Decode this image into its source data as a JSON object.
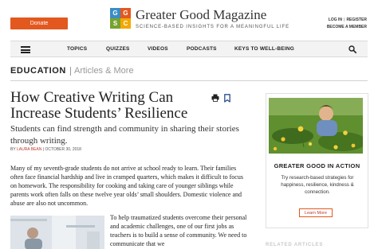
{
  "header": {
    "donate_label": "Donate",
    "logo_letters": [
      "G",
      "G",
      "S",
      "C"
    ],
    "logo_colors": [
      "#3a8dc4",
      "#e3581f",
      "#78a22f",
      "#f2a900"
    ],
    "title": "Greater Good Magazine",
    "tagline": "SCIENCE-BASED INSIGHTS FOR A MEANINGFUL LIFE",
    "log_in": "LOG IN",
    "separator": "|",
    "register": "REGISTER",
    "become_member": "BECOME A MEMBER"
  },
  "nav": {
    "menu_icon": "hamburger-icon",
    "items": [
      "TOPICS",
      "QUIZZES",
      "VIDEOS",
      "PODCASTS",
      "KEYS TO WELL-BEING"
    ],
    "search_icon": "search-icon"
  },
  "section": {
    "label": "EDUCATION",
    "sub": "Articles & More"
  },
  "article": {
    "headline": "How Creative Writing Can Increase Students’ Resilience",
    "dek": "Students can find strength and community in sharing their stories through writing.",
    "byline_prefix": "BY ",
    "author": "LAURA BEAN",
    "date_sep": " | ",
    "date": "OCTOBER 30, 2018",
    "paragraph1": "Many of my seventh-grade students do not arrive at school ready to learn. Their families often face financial hardship and live in cramped quarters, which makes it difficult to focus on homework. The responsibility for cooking and taking care of younger siblings while parents work often falls on these twelve year olds’ small shoulders. Domestic violence and abuse are also not uncommon.",
    "paragraph2": "To help traumatized students overcome their personal and academic challenges, one of our first jobs as teachers is to build a sense of community. We need to communicate that we",
    "print_icon": "print-icon",
    "bookmark_icon": "bookmark-icon"
  },
  "sidebar": {
    "promo_title": "GREATER GOOD IN ACTION",
    "promo_text": "Try research-based strategies for happiness, resilience, kindness & connection.",
    "learn_more": "Learn More",
    "related_label": "RELATED ARTICLES"
  },
  "colors": {
    "accent": "#e3581f",
    "author_red": "#c0392b"
  }
}
